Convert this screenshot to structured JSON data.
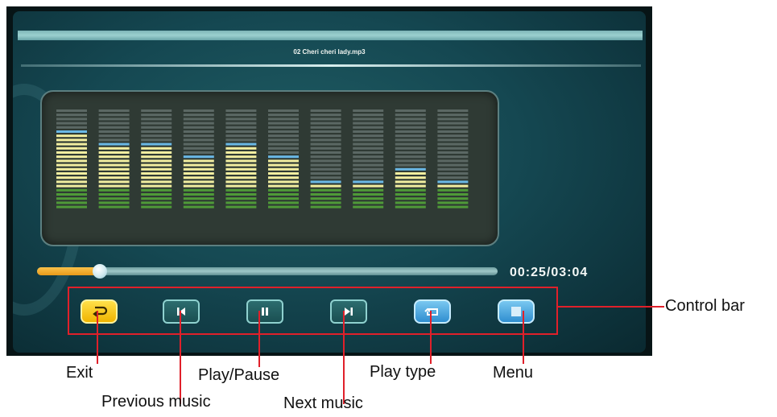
{
  "player": {
    "track_title": "02 Cheri cheri lady.mp3",
    "time_display": "00:25/03:04",
    "progress_fraction": 0.136
  },
  "equalizer": {
    "bands_total_segments": 24,
    "levels": [
      18,
      15,
      15,
      12,
      15,
      12,
      6,
      6,
      9,
      6
    ],
    "colors": {
      "empty": "#6b7874",
      "green": "#4f9a38",
      "yellow": "#f2eea0",
      "peak": "#6ab8e6"
    }
  },
  "controls": [
    {
      "id": "exit",
      "icon": "return-icon",
      "label": "Exit"
    },
    {
      "id": "previous",
      "icon": "skip-previous-icon",
      "label": "Previous music"
    },
    {
      "id": "play_pause",
      "icon": "pause-icon",
      "label": "Play/Pause"
    },
    {
      "id": "next",
      "icon": "skip-next-icon",
      "label": "Next music"
    },
    {
      "id": "play_type",
      "icon": "repeat-icon",
      "label": "Play type"
    },
    {
      "id": "menu",
      "icon": "menu-icon",
      "label": "Menu"
    }
  ],
  "annotations": {
    "control_bar": "Control bar"
  },
  "colors": {
    "annotation_red": "#e0202a",
    "progress_orange": "#f0aa2a"
  }
}
